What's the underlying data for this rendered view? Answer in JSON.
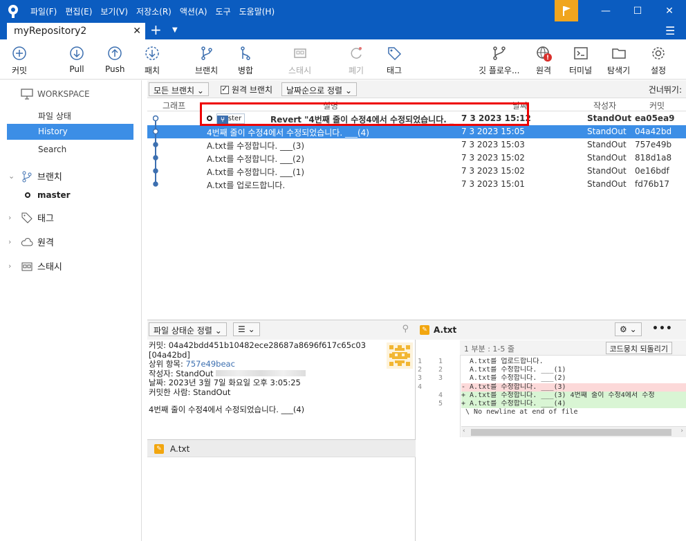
{
  "window": {
    "menu": [
      "파일(F)",
      "편집(E)",
      "보기(V)",
      "저장소(R)",
      "액션(A)",
      "도구",
      "도움말(H)"
    ],
    "tab_title": "myRepository2"
  },
  "toolbar": {
    "commit": "커밋",
    "pull": "Pull",
    "push": "Push",
    "fetch": "패치",
    "branch": "브랜치",
    "merge": "병합",
    "stash": "스태시",
    "discard": "폐기",
    "tag": "태그",
    "git_flow": "깃 플로우...",
    "remote": "원격",
    "terminal": "터미널",
    "explorer": "탐색기",
    "settings": "설정"
  },
  "sidebar": {
    "workspace": "WORKSPACE",
    "file_status": "파일 상태",
    "history": "History",
    "search": "Search",
    "branches": "브랜치",
    "branch_master": "master",
    "tags": "태그",
    "remotes": "원격",
    "stashes": "스태시"
  },
  "filters": {
    "all_branches": "모든 브랜치",
    "remote_branches": "원격 브랜치",
    "sort_by_date": "날짜순으로 정렬",
    "skip": "건너뛰기:"
  },
  "columns": {
    "graph": "그래프",
    "description": "설명",
    "date": "날짜",
    "author": "작성자",
    "commit": "커밋"
  },
  "commits": [
    {
      "branch_tag": "master",
      "description": "Revert \"4번째 줄이 수정4에서 수정되었습니다. _",
      "date": "7 3 2023 15:12",
      "author": "StandOut",
      "hash": "ea05ea9"
    },
    {
      "branch_tag": "",
      "description": "4번째 줄이 수정4에서 수정되었습니다. ___(4)",
      "date": "7 3 2023 15:05",
      "author": "StandOut",
      "hash": "04a42bd"
    },
    {
      "branch_tag": "",
      "description": "A.txt를 수정합니다. ___(3)",
      "date": "7 3 2023 15:03",
      "author": "StandOut",
      "hash": "757e49b"
    },
    {
      "branch_tag": "",
      "description": "A.txt를 수정합니다. ___(2)",
      "date": "7 3 2023 15:02",
      "author": "StandOut",
      "hash": "818d1a8"
    },
    {
      "branch_tag": "",
      "description": "A.txt를 수정합니다. ___(1)",
      "date": "7 3 2023 15:02",
      "author": "StandOut",
      "hash": "0e16bdf"
    },
    {
      "branch_tag": "",
      "description": "A.txt를 업로드합니다.",
      "date": "7 3 2023 15:01",
      "author": "StandOut",
      "hash": "fd76b17"
    }
  ],
  "selected_commit_index": 1,
  "details": {
    "sort_label": "파일 상태순 정렬",
    "commit_line": "커밋: 04a42bdd451b10482ece28687a8696f617c65c03",
    "short_hash": "[04a42bd]",
    "parent_label": "상위 항목: ",
    "parent_hash": "757e49beac",
    "author_line": "작성자: StandOut",
    "date_line": "날짜: 2023년 3월 7일 화요일 오후 3:05:25",
    "committer_line": "커밋한 사람: StandOut",
    "message": "4번째 줄이 수정4에서 수정되었습니다. ___(4)",
    "file": "A.txt"
  },
  "diff": {
    "file": "A.txt",
    "hunk": "1 부분 : 1-5 줄",
    "revert_label": "코드뭉치 되돌리기",
    "lines": [
      {
        "old": "1",
        "new": "1",
        "type": "ctx",
        "text": "  A.txt를 업로드합니다."
      },
      {
        "old": "2",
        "new": "2",
        "type": "ctx",
        "text": "  A.txt를 수정합니다. ___(1)"
      },
      {
        "old": "3",
        "new": "3",
        "type": "ctx",
        "text": "  A.txt를 수정합니다. ___(2)"
      },
      {
        "old": "4",
        "new": "",
        "type": "del",
        "text": "- A.txt를 수정합니다. ___(3)"
      },
      {
        "old": "",
        "new": "4",
        "type": "add",
        "text": "+ A.txt를 수정합니다. ___(3) 4번째 줄이 수정4에서 수정"
      },
      {
        "old": "",
        "new": "5",
        "type": "add",
        "text": "+ A.txt를 수정합니다. ___(4)"
      },
      {
        "old": "",
        "new": "",
        "type": "ctx",
        "text": " \\ No newline at end of file"
      }
    ]
  },
  "colors": {
    "titlebar": "#0b5cc0",
    "selection": "#3c8ee6",
    "flag": "#f0a51e",
    "highlight_box": "#e00000",
    "diff_add": "#d9f5d4",
    "diff_del": "#fcd9d9"
  }
}
